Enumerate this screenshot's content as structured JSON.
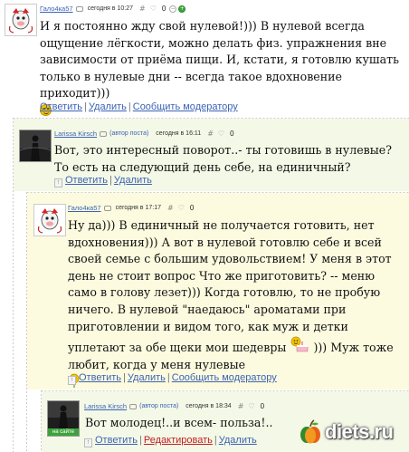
{
  "comments": [
    {
      "author": "Гало4ка57",
      "tag": "",
      "date": "сегодня в 10:27",
      "hash": "#",
      "heart": "♡",
      "score": "0",
      "text": "И я постоянно жду свой нулевой!))) В нулевой всегда ощущение лёгкости, можно делать физ. упражнения вне зависимости от приёма пищи. И, кстати, я готовлю кушать только в нулевые дни -- всегда такое вдохновение приходит)))",
      "actions": [
        "Ответить",
        "Удалить",
        "Сообщить модератору"
      ]
    },
    {
      "author": "Larissa Kirsch",
      "tag": "(автор поста)",
      "date": "сегодня в 16:11",
      "hash": "#",
      "heart": "♡",
      "score": "0",
      "text": "Вот, это интересный поворот..- ты готовишь в нулевые? То есть на следующий день себе, на единичный?",
      "actions": [
        "Ответить",
        "Удалить"
      ]
    },
    {
      "author": "Гало4ка57",
      "tag": "",
      "date": "сегодня в 17:17",
      "hash": "#",
      "heart": "♡",
      "score": "0",
      "text_before": "Ну да))) В единичный не получается готовить, нет вдохновения))) А вот в нулевой готовлю себе и всей своей семье с большим удовольствием! У меня в этот день не стоит вопрос Что же приготовить? -- меню само в голову лезет))) Когда готовлю, то не пробую ничего. В нулевой \"наедаюсь\" ароматами при приготовлении и видом того, как муж и детки уплетают за обе щеки мои шедевры",
      "text_after": "))) Муж тоже любит, когда у меня нулевые",
      "actions": [
        "Ответить",
        "Удалить",
        "Сообщить модератору"
      ]
    },
    {
      "author": "Larissa Kirsch",
      "tag": "(автор поста)",
      "date": "сегодня в 18:34",
      "hash": "#",
      "heart": "♡",
      "score": "0",
      "avatar_caption": "на сайте",
      "text": "Вот молодец!..и всем- польза!..",
      "actions": [
        "Ответить",
        "Редактировать",
        "Удалить"
      ]
    }
  ],
  "watermark": {
    "text": "diets.ru"
  },
  "colors": {
    "link": "#3b63b5",
    "edit_link": "#c02020",
    "author_bg": "#f4f8e6",
    "reply_bg": "#fcfbdf",
    "thread_line": "#cccccc",
    "vote_plus": "#3ca33c"
  },
  "icons": {
    "vote_minus": "−",
    "vote_plus": "+",
    "up": "↑"
  }
}
